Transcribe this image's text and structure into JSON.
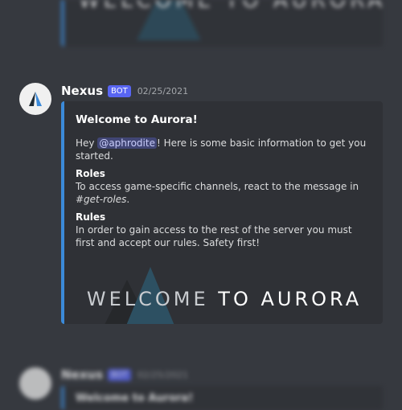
{
  "accent_color": "#3b8ad9",
  "bot_tag_color": "#5865f2",
  "top_message": {
    "banner_text": "WELCOME TO AURORA"
  },
  "message": {
    "username": "Nexus",
    "bot_tag": "BOT",
    "timestamp": "02/25/2021",
    "avatar_icon": "aurora-logo-icon",
    "embed": {
      "title": "Welcome to Aurora!",
      "desc_prefix": "Hey ",
      "mention": "@aphrodite",
      "desc_suffix": "! Here is some basic information to get you started.",
      "fields": [
        {
          "name": "Roles",
          "value_prefix": "To access game-specific channels, react to the message in ",
          "value_em": "#get-roles",
          "value_suffix": "."
        },
        {
          "name": "Rules",
          "value": "In order to gain access to the rest of the server you must first and accept our rules. Safety first!"
        }
      ],
      "banner_part1": "WELCOME ",
      "banner_part2": "TO AURORA"
    }
  },
  "next_message": {
    "username": "Nexus",
    "bot_tag": "BOT",
    "timestamp": "02/25/2021",
    "embed_title": "Welcome to Aurora!"
  }
}
